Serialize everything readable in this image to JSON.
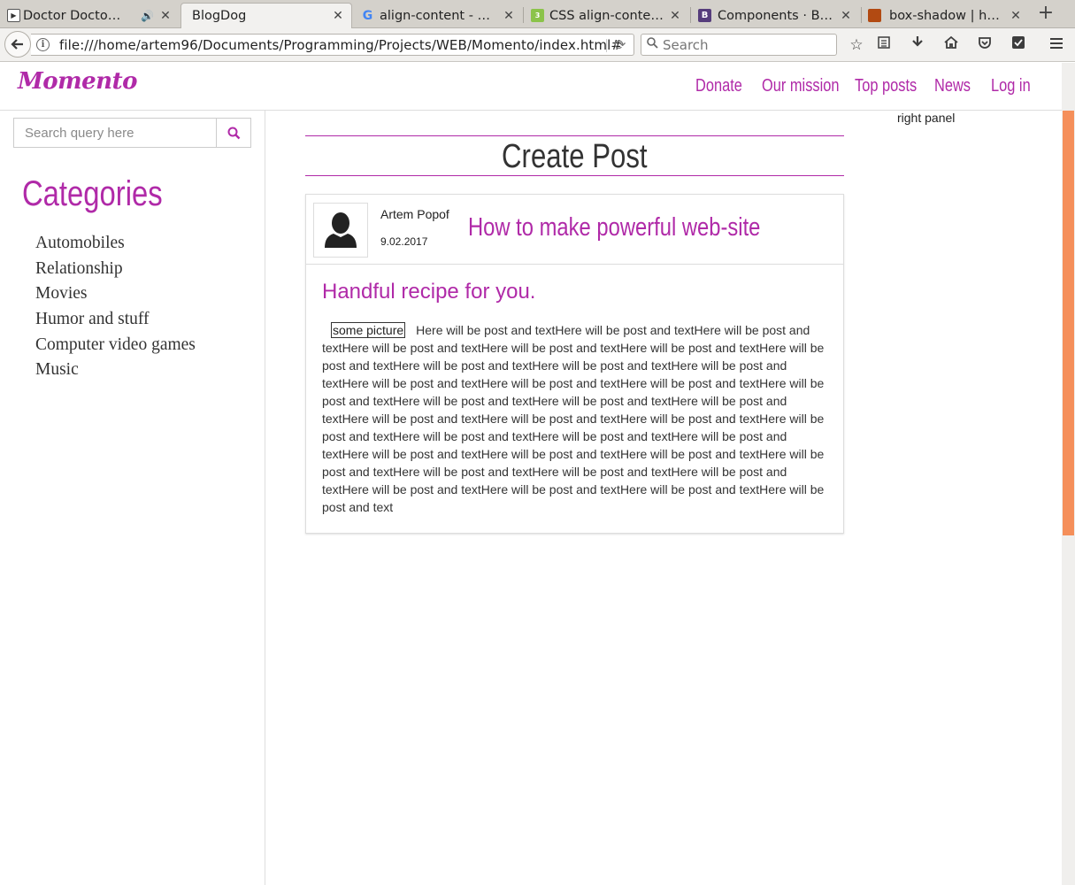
{
  "browser": {
    "tabs": [
      {
        "title": "Doctor Docto…",
        "favicon": "play-icon"
      },
      {
        "title": "BlogDog",
        "favicon": ""
      },
      {
        "title": "align-content - П…",
        "favicon": "google-icon"
      },
      {
        "title": "CSS align-conten…",
        "favicon": "css3-icon"
      },
      {
        "title": "Components · Bo…",
        "favicon": "bootstrap-icon"
      },
      {
        "title": "box-shadow | ht…",
        "favicon": "site-icon"
      }
    ],
    "url": "file:///home/artem96/Documents/Programming/Projects/WEB/Momento/index.html#",
    "search_placeholder": "Search",
    "accent_color": "#f58f5a"
  },
  "site": {
    "logo": "Momento",
    "brand_color": "#b02aa8",
    "menu": [
      "Donate",
      "Our mission",
      "Top posts",
      "News",
      "Log in"
    ]
  },
  "sidebar": {
    "search_placeholder": "Search query here",
    "categories_title": "Categories",
    "categories": [
      "Automobiles",
      "Relationship",
      "Movies",
      "Humor and stuff",
      "Computer video games",
      "Music"
    ]
  },
  "main": {
    "heading": "Create Post",
    "post": {
      "author": "Artem Popof",
      "date": "9.02.2017",
      "title": "How to make powerful web-site",
      "subtitle": "Handful recipe for you.",
      "picture_label": "some picture",
      "body": "Here will be post and textHere will be post and textHere will be post and textHere will be post and textHere will be post and textHere will be post and textHere will be post and textHere will be post and textHere will be post and textHere will be post and textHere will be post and textHere will be post and textHere will be post and textHere will be post and textHere will be post and textHere will be post and textHere will be post and textHere will be post and textHere will be post and textHere will be post and textHere will be post and textHere will be post and textHere will be post and textHere will be post and textHere will be post and textHere will be post and textHere will be post and textHere will be post and textHere will be post and textHere will be post and textHere will be post and textHere will be post and textHere will be post and textHere will be post and textHere will be post and text"
    }
  },
  "right_panel": {
    "label": "right panel"
  }
}
